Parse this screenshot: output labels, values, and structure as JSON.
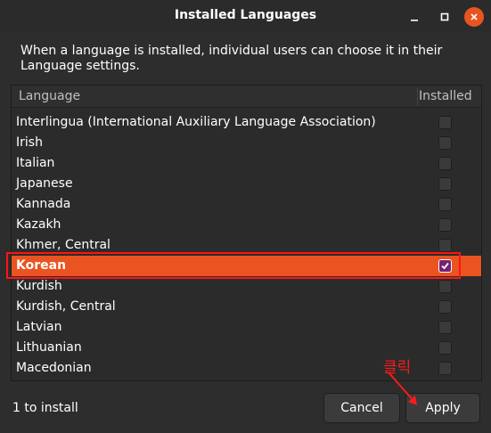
{
  "window": {
    "title": "Installed Languages",
    "controls": [
      "minimize",
      "maximize",
      "close"
    ]
  },
  "description": "When a language is installed, individual users can choose it in their Language settings.",
  "list": {
    "columns": [
      "Language",
      "Installed"
    ],
    "rows": [
      {
        "label": "Interlingua (International Auxiliary Language Association)",
        "checked": false
      },
      {
        "label": "Irish",
        "checked": false
      },
      {
        "label": "Italian",
        "checked": false
      },
      {
        "label": "Japanese",
        "checked": false
      },
      {
        "label": "Kannada",
        "checked": false
      },
      {
        "label": "Kazakh",
        "checked": false
      },
      {
        "label": "Khmer, Central",
        "checked": false
      },
      {
        "label": "Korean",
        "checked": true,
        "selected": true
      },
      {
        "label": "Kurdish",
        "checked": false
      },
      {
        "label": "Kurdish, Central",
        "checked": false
      },
      {
        "label": "Latvian",
        "checked": false
      },
      {
        "label": "Lithuanian",
        "checked": false
      },
      {
        "label": "Macedonian",
        "checked": false
      }
    ]
  },
  "footer": {
    "status": "1 to install",
    "cancel_label": "Cancel",
    "apply_label": "Apply"
  },
  "annotation": {
    "text": "클릭",
    "color": "#ff1a1a"
  },
  "colors": {
    "accent": "#e95420",
    "checkbox_checked": "#77216f"
  }
}
